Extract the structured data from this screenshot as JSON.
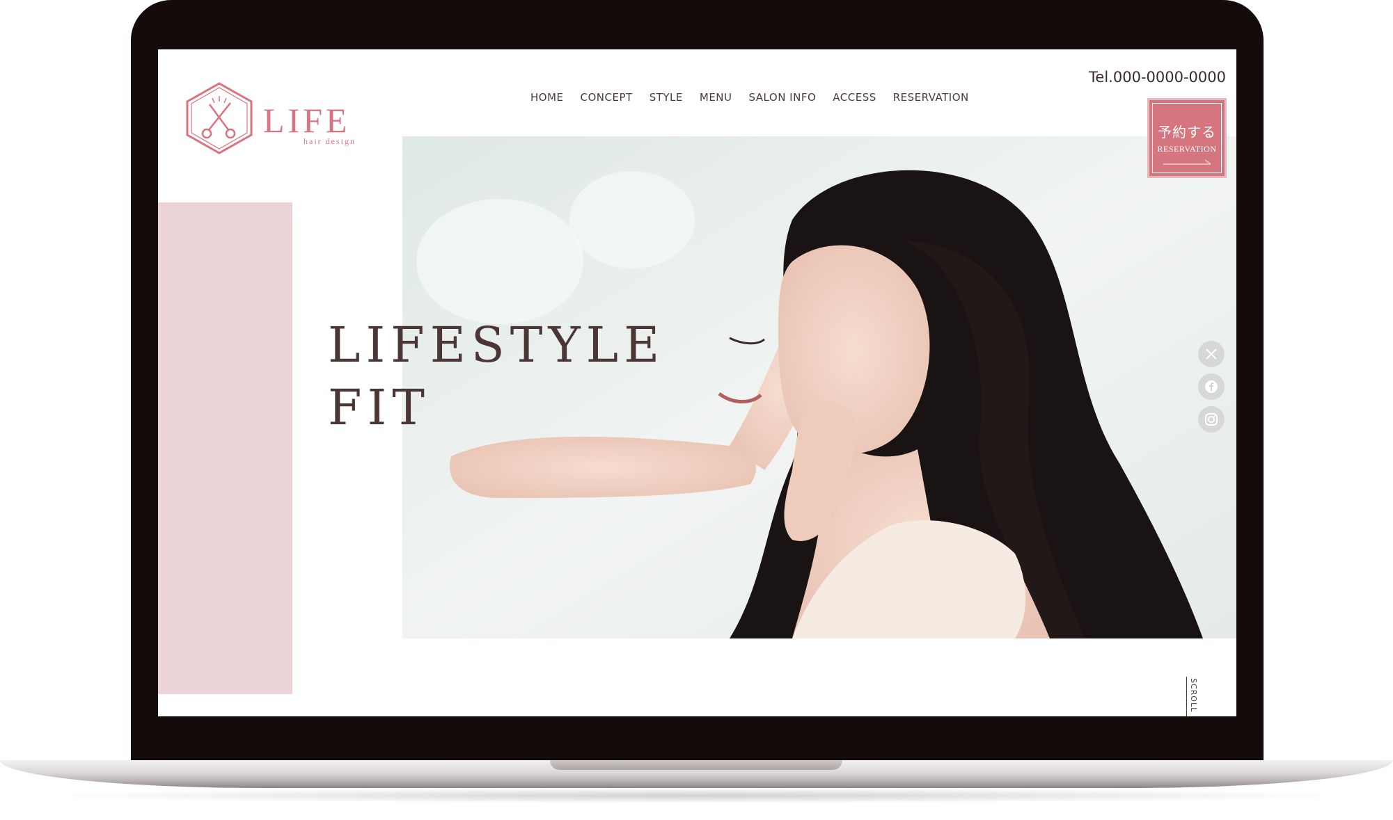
{
  "logo": {
    "word": "LIFE",
    "tagline": "hair design"
  },
  "nav": {
    "items": [
      "HOME",
      "CONCEPT",
      "STYLE",
      "MENU",
      "SALON INFO",
      "ACCESS",
      "RESERVATION"
    ]
  },
  "header": {
    "tel": "Tel.000-0000-0000"
  },
  "hero": {
    "line1": "LIFESTYLE",
    "line2": "FIT"
  },
  "reserve": {
    "jp": "予約する",
    "en": "RESERVATION"
  },
  "social": [
    "x-icon",
    "facebook-icon",
    "instagram-icon"
  ],
  "scroll": {
    "label": "SCROLL"
  },
  "colors": {
    "accent": "#d4757f",
    "pink_block": "#ecd3d6",
    "text": "#4b3636",
    "frame": "#140b0b"
  }
}
